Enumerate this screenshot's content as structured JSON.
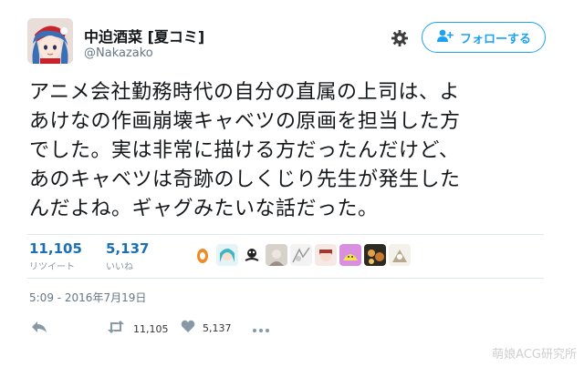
{
  "author": {
    "display_name": "中迫酒菜 [夏コミ]",
    "handle": "@Nakazako"
  },
  "follow_button": {
    "label": "フォローする",
    "icon": "add-user-icon"
  },
  "settings": {
    "icon": "gear-icon"
  },
  "tweet": {
    "lines": [
      "アニメ会社勤務時代の自分の直属の上司は、よ",
      "あけなの作画崩壊キャベツの原画を担当した方",
      "でした。実は非常に描ける方だったんだけど、",
      "あのキャベツは奇跡のしくじり先生が発生した",
      "んだよね。ギャグみたいな話だった。"
    ]
  },
  "stats": {
    "retweets": {
      "count": "11,105",
      "label": "リツイート"
    },
    "likes": {
      "count": "5,137",
      "label": "いいね"
    }
  },
  "liker_avatars": [
    "avatar-1",
    "avatar-2",
    "avatar-3",
    "avatar-4",
    "avatar-5",
    "avatar-6",
    "avatar-7",
    "avatar-8",
    "avatar-9"
  ],
  "timestamp": "5:09 - 2016年7月19日",
  "actions": {
    "reply": {
      "icon": "reply-icon"
    },
    "retweet": {
      "icon": "retweet-icon",
      "count": "11,105"
    },
    "like": {
      "icon": "heart-icon",
      "count": "5,137"
    },
    "more": {
      "icon": "more-icon"
    }
  },
  "watermark": "萌娘ACG研究所",
  "colors": {
    "accent": "#1da1f2",
    "stat_number": "#1b70b5",
    "muted": "#657786"
  }
}
